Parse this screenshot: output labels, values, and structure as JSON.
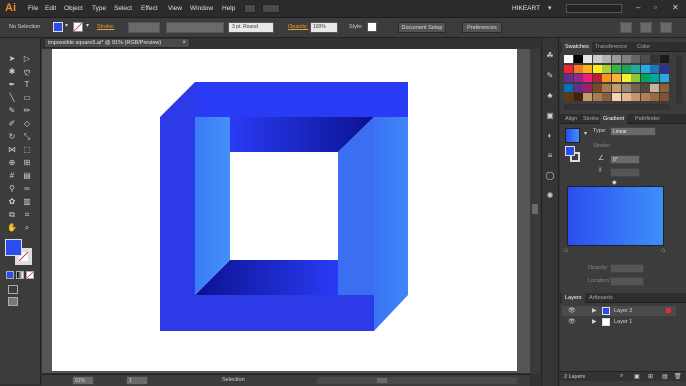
{
  "app": {
    "logo": "Ai",
    "workspace": "HIKEART"
  },
  "menu": [
    "File",
    "Edit",
    "Object",
    "Type",
    "Select",
    "Effect",
    "View",
    "Window",
    "Help"
  ],
  "control": {
    "selection_label": "No Selection",
    "stroke_label": "Stroke:",
    "brush_value": "3 pt. Round",
    "opacity_label": "Opacity:",
    "opacity_value": "100%",
    "style_label": "Style:",
    "document_setup": "Document Setup",
    "preferences": "Preferences"
  },
  "document": {
    "tab_title": "impossible square5.ai* @ 91% (RGB/Preview)"
  },
  "status": {
    "zoom": "91%",
    "page": "1",
    "mode": "Selection"
  },
  "swatches_panel": {
    "tabs": [
      "Swatches",
      "Transference",
      "Color"
    ],
    "colors": [
      "#ffffff",
      "#000000",
      "#e6e6e6",
      "#cccccc",
      "#b3b3b3",
      "#999999",
      "#808080",
      "#666666",
      "#4d4d4d",
      "#333333",
      "#1a1a1a",
      "#f42434",
      "#f57a1f",
      "#f7b21c",
      "#fdee1d",
      "#a6ce39",
      "#3ab54a",
      "#1fa15a",
      "#24a89b",
      "#27a9e1",
      "#1b75bb",
      "#2e3192",
      "#652d91",
      "#92278f",
      "#ed1e79",
      "#be1e2d",
      "#f7941d",
      "#fcb040",
      "#f9ed32",
      "#8dc63f",
      "#00a651",
      "#00a99d",
      "#29abe2",
      "#0072bc",
      "#662d91",
      "#9e1f63",
      "#754c24",
      "#a97c50",
      "#c69c6d",
      "#998675",
      "#736357",
      "#534741",
      "#c2b59b",
      "#8c6239",
      "#603813",
      "#42210b",
      "#c49a6c",
      "#a67c52",
      "#8b5e3c",
      "#f5d5b5",
      "#e0b98f",
      "#c7956d",
      "#b07d54",
      "#9b6a45",
      "#805334"
    ]
  },
  "gradient_panel": {
    "tabs": [
      "Align",
      "Stroke",
      "Gradient",
      "Pathfinder"
    ],
    "type_label": "Type:",
    "type_value": "Linear",
    "stroke_label": "Stroke:",
    "angle_value": "0°",
    "opacity_label": "Opacity:",
    "location_label": "Location:",
    "start_color": "#2b4df0",
    "end_color": "#3d90fb"
  },
  "layers_panel": {
    "tabs": [
      "Layers",
      "Artboards"
    ],
    "layers": [
      {
        "name": "Layer 2"
      },
      {
        "name": "Layer 1"
      }
    ],
    "footer": "2 Layers"
  },
  "artwork": {
    "colors": {
      "left_face": "#2d3ae8",
      "top_face": "#2a3bf5",
      "right_face": "#3a73f4",
      "front_top": "#3a7cf6",
      "dark_shadow": "#0b1290"
    }
  }
}
